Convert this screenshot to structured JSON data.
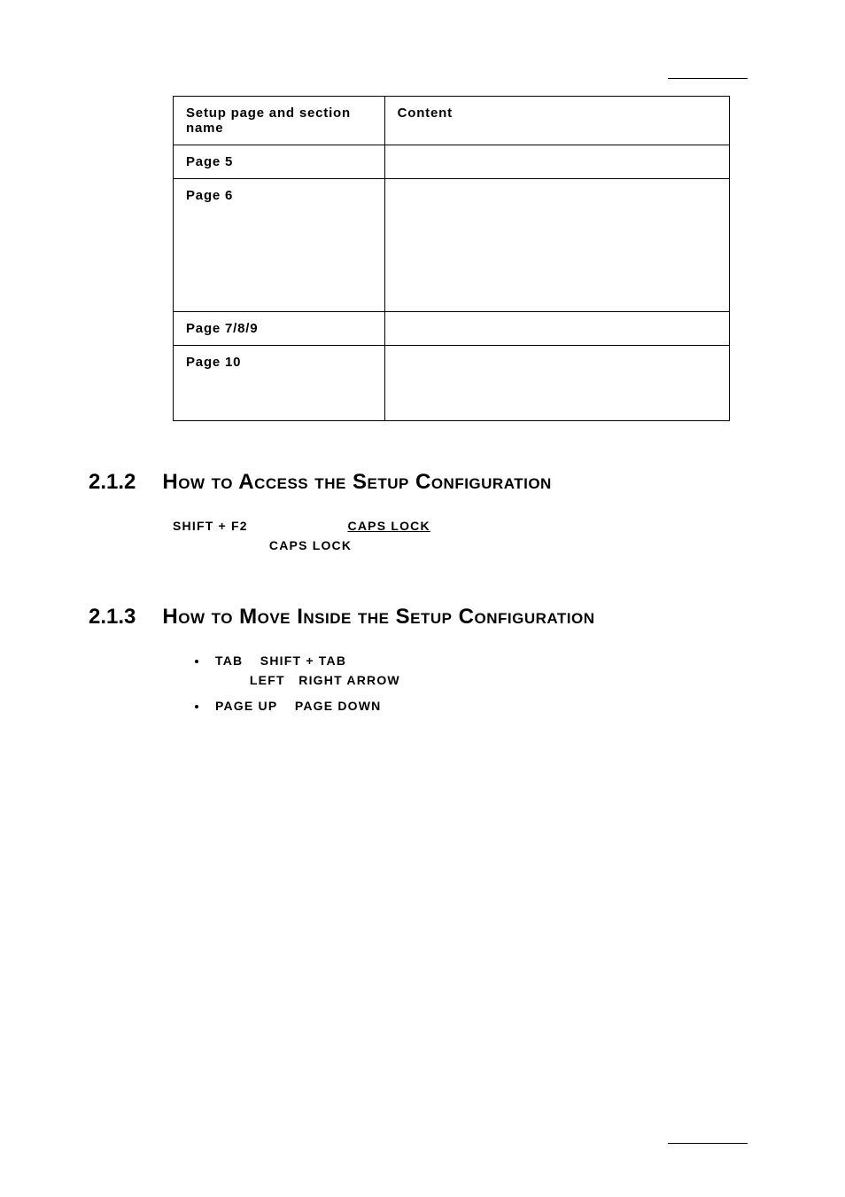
{
  "table": {
    "header": {
      "col1": "Setup page and section name",
      "col2": "Content"
    },
    "rows": [
      {
        "label": "Page 5",
        "content": ""
      },
      {
        "label": "Page 6",
        "content": ""
      },
      {
        "label": "Page 7/8/9",
        "content": ""
      },
      {
        "label": "Page 10",
        "content": ""
      }
    ]
  },
  "sections": [
    {
      "number": "2.1.2",
      "title": "How to Access the Setup Configuration",
      "keys": [
        "SHIFT + F2",
        "       CAPS LOCK          ",
        "CAPS LOCK"
      ]
    },
    {
      "number": "2.1.3",
      "title": "How to Move Inside the Setup Configuration",
      "bullets": [
        {
          "keys": [
            "TAB",
            "SHIFT + TAB",
            "LEFT",
            "RIGHT ARROW"
          ]
        },
        {
          "keys": [
            "PAGE UP",
            "PAGE DOWN"
          ]
        }
      ]
    }
  ]
}
